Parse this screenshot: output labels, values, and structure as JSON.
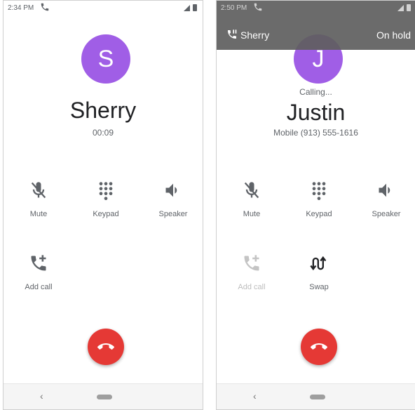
{
  "left": {
    "status": {
      "time": "2:34 PM"
    },
    "avatar_letter": "S",
    "name": "Sherry",
    "duration": "00:09",
    "controls": {
      "mute": "Mute",
      "keypad": "Keypad",
      "speaker": "Speaker",
      "add_call": "Add call"
    },
    "nav": {
      "back": "‹"
    }
  },
  "right": {
    "status": {
      "time": "2:50 PM"
    },
    "hold_banner": {
      "name": "Sherry",
      "state": "On hold"
    },
    "avatar_letter": "J",
    "call_state": "Calling...",
    "name": "Justin",
    "number": "Mobile (913) 555-1616",
    "controls": {
      "mute": "Mute",
      "keypad": "Keypad",
      "speaker": "Speaker",
      "add_call": "Add call",
      "swap": "Swap"
    },
    "nav": {
      "back": "‹"
    }
  },
  "colors": {
    "avatar": "#a05ee6",
    "end_call": "#e53935",
    "hold_banner": "#5f5f5f"
  },
  "icons": [
    "phone-icon",
    "mute-icon",
    "keypad-icon",
    "speaker-icon",
    "add-call-icon",
    "swap-icon",
    "end-call-icon",
    "call-hold-icon"
  ]
}
